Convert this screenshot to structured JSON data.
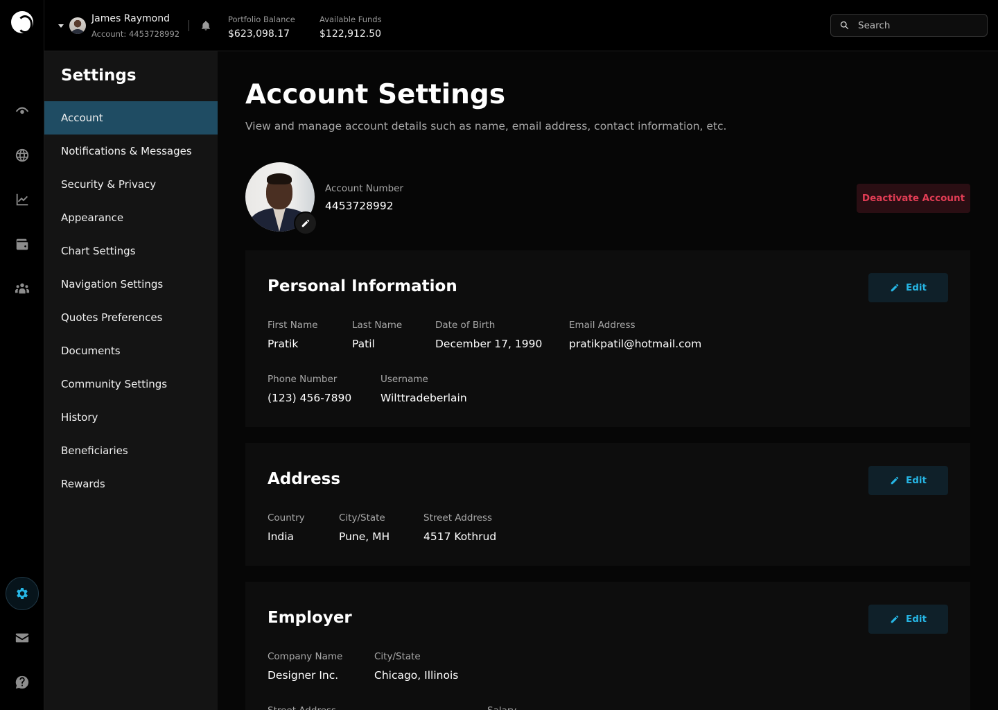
{
  "rail": {
    "icons": [
      "logo-icon",
      "watchlist-eye-icon",
      "globe-icon",
      "trending-chart-icon",
      "wallet-icon",
      "community-group-icon",
      "settings-gear-icon",
      "mail-icon",
      "help-icon"
    ]
  },
  "header": {
    "user_name": "James Raymond",
    "account_label": "Account: 4453728992",
    "portfolio_label": "Portfolio Balance",
    "portfolio_value": "$623,098.17",
    "funds_label": "Available Funds",
    "funds_value": "$122,912.50",
    "search_placeholder": "Search"
  },
  "menu": {
    "title": "Settings",
    "items": [
      {
        "label": "Account",
        "active": true
      },
      {
        "label": "Notifications & Messages"
      },
      {
        "label": "Security & Privacy"
      },
      {
        "label": "Appearance"
      },
      {
        "label": "Chart Settings"
      },
      {
        "label": "Navigation Settings"
      },
      {
        "label": "Quotes Preferences"
      },
      {
        "label": "Documents"
      },
      {
        "label": "Community Settings"
      },
      {
        "label": "History"
      },
      {
        "label": "Beneficiaries"
      },
      {
        "label": "Rewards"
      }
    ]
  },
  "main": {
    "title": "Account Settings",
    "subtitle": "View and manage account details such as name, email address, contact information, etc.",
    "account_number_label": "Account Number",
    "account_number": "4453728992",
    "deactivate_label": "Deactivate Account",
    "edit_label": "Edit",
    "personal": {
      "title": "Personal Information",
      "first_name_label": "First Name",
      "first_name": "Pratik",
      "last_name_label": "Last Name",
      "last_name": "Patil",
      "dob_label": "Date of Birth",
      "dob": "December 17, 1990",
      "email_label": "Email Address",
      "email": "pratikpatil@hotmail.com",
      "phone_label": "Phone Number",
      "phone": "(123) 456-7890",
      "username_label": "Username",
      "username": "Wilttradeberlain"
    },
    "address": {
      "title": "Address",
      "country_label": "Country",
      "country": "India",
      "city_label": "City/State",
      "city": "Pune, MH",
      "street_label": "Street Address",
      "street": "4517 Kothrud"
    },
    "employer": {
      "title": "Employer",
      "company_label": "Company Name",
      "company": "Designer Inc.",
      "city_label": "City/State",
      "city": "Chicago, Illinois",
      "street_label": "Street Address",
      "salary_label": "Salary"
    }
  },
  "colors": {
    "accent": "#26b6e5",
    "active_menu": "#1f4c63",
    "danger": "#e23d55"
  }
}
